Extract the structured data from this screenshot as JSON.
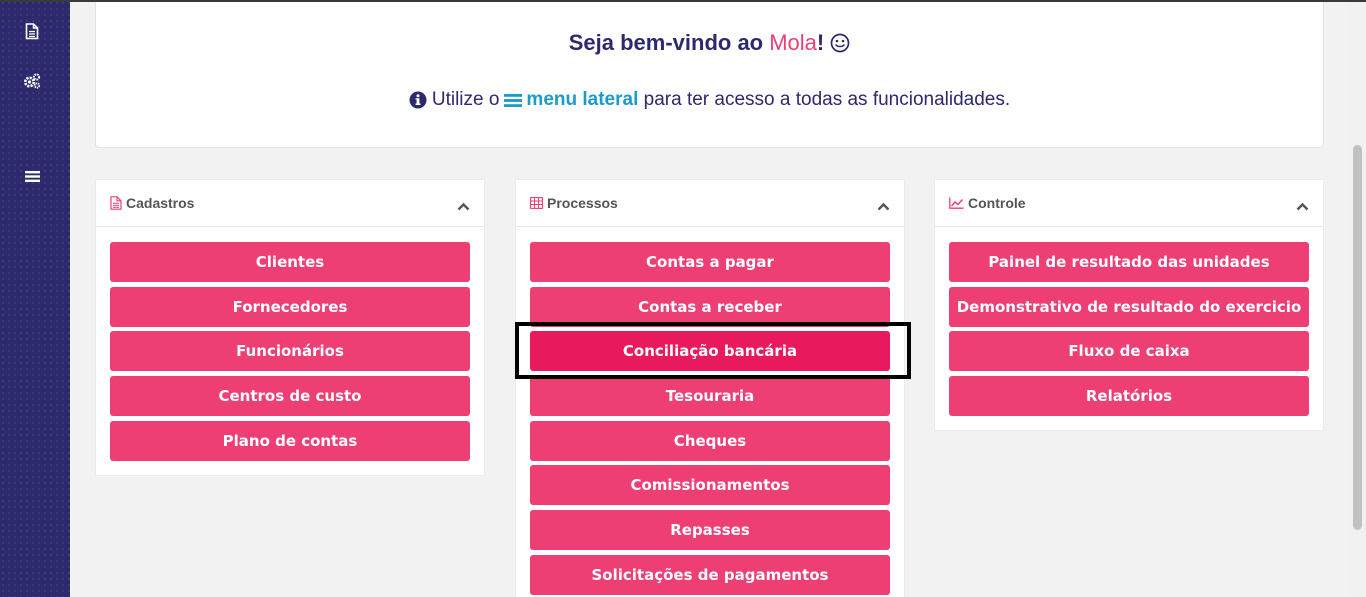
{
  "welcome": {
    "title_prefix": "Seja bem-vindo ao ",
    "brand": "Mola",
    "title_suffix": "!",
    "sub_prefix": "Utilize o",
    "sub_link": "menu lateral",
    "sub_suffix": " para ter acesso a todas as funcionalidades."
  },
  "sidebar": {
    "icons": [
      "document-icon",
      "cogs-icon",
      "hamburger-menu-icon"
    ]
  },
  "cadastros": {
    "title": "Cadastros",
    "buttons": [
      "Clientes",
      "Fornecedores",
      "Funcionários",
      "Centros de custo",
      "Plano de contas"
    ]
  },
  "processos": {
    "title": "Processos",
    "buttons": [
      "Contas a pagar",
      "Contas a receber",
      "Conciliação bancária",
      "Tesouraria",
      "Cheques",
      "Comissionamentos",
      "Repasses",
      "Solicitações de pagamentos"
    ]
  },
  "controle": {
    "title": "Controle",
    "buttons": [
      "Painel de resultado das unidades",
      "Demonstrativo de resultado do exercicio",
      "Fluxo de caixa",
      "Relatórios"
    ]
  },
  "colors": {
    "sidebar": "#2c2a6c",
    "accent": "#ee3f74",
    "link": "#1a9bc9"
  }
}
